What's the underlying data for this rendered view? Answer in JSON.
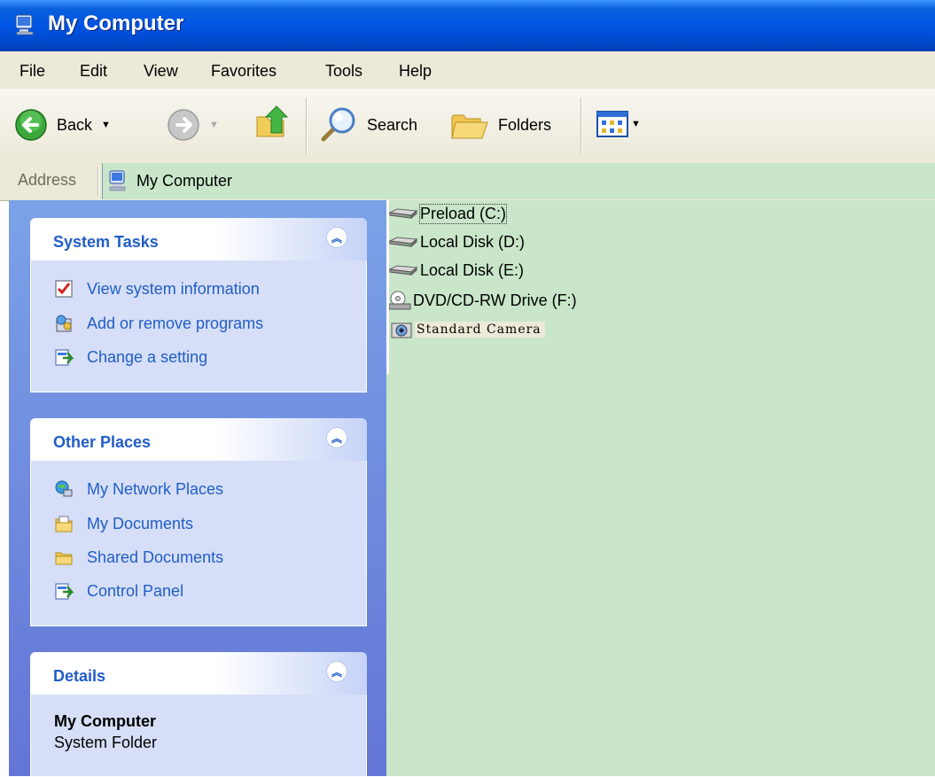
{
  "window": {
    "title": "My Computer"
  },
  "menu": [
    "File",
    "Edit",
    "View",
    "Favorites",
    "Tools",
    "Help"
  ],
  "toolbar": {
    "back_label": "Back",
    "search_label": "Search",
    "folders_label": "Folders"
  },
  "address": {
    "label": "Address",
    "value": "My Computer"
  },
  "panels": {
    "system_tasks": {
      "title": "System Tasks",
      "items": [
        "View system information",
        "Add or remove programs",
        "Change a setting"
      ]
    },
    "other_places": {
      "title": "Other Places",
      "items": [
        "My Network Places",
        "My Documents",
        "Shared Documents",
        "Control Panel"
      ]
    },
    "details": {
      "title": "Details",
      "name": "My Computer",
      "type": "System Folder"
    }
  },
  "drives": [
    "Preload (C:)",
    "Local Disk (D:)",
    "Local Disk (E:)",
    "DVD/CD-RW Drive (F:)",
    "Standard Camera"
  ],
  "colors": {
    "titlebar": "#0054e3",
    "content_bg": "#c9e6ca",
    "sidebar_bg": "#6f8ce0",
    "link": "#215dc6"
  }
}
